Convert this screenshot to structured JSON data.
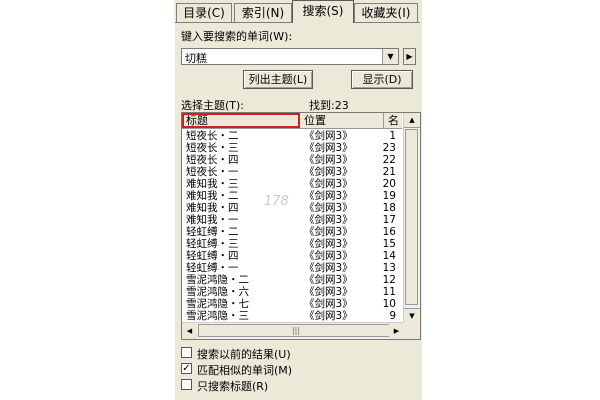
{
  "tabs": [
    {
      "label": "目录(C)"
    },
    {
      "label": "索引(N)"
    },
    {
      "label": "搜索(S)"
    },
    {
      "label": "收藏夹(I)"
    }
  ],
  "search": {
    "prompt": "键入要搜索的单词(W):",
    "value": "切糕",
    "list_topics_label": "列出主题(L)",
    "display_label": "显示(D)"
  },
  "results": {
    "select_label": "选择主题(T):",
    "found_label": "找到:23",
    "columns": [
      "标题",
      "位置",
      "名"
    ],
    "rows": [
      {
        "title": "短夜长・二",
        "location": "《剑网3》",
        "rank": "1"
      },
      {
        "title": "短夜长・三",
        "location": "《剑网3》",
        "rank": "23"
      },
      {
        "title": "短夜长・四",
        "location": "《剑网3》",
        "rank": "22"
      },
      {
        "title": "短夜长・一",
        "location": "《剑网3》",
        "rank": "21"
      },
      {
        "title": "难知我・三",
        "location": "《剑网3》",
        "rank": "20"
      },
      {
        "title": "难知我・二",
        "location": "《剑网3》",
        "rank": "19"
      },
      {
        "title": "难知我・四",
        "location": "《剑网3》",
        "rank": "18"
      },
      {
        "title": "难知我・一",
        "location": "《剑网3》",
        "rank": "17"
      },
      {
        "title": "轻虹缚・二",
        "location": "《剑网3》",
        "rank": "16"
      },
      {
        "title": "轻虹缚・三",
        "location": "《剑网3》",
        "rank": "15"
      },
      {
        "title": "轻虹缚・四",
        "location": "《剑网3》",
        "rank": "14"
      },
      {
        "title": "轻虹缚・一",
        "location": "《剑网3》",
        "rank": "13"
      },
      {
        "title": "雪泥鸿隐・二",
        "location": "《剑网3》",
        "rank": "12"
      },
      {
        "title": "雪泥鸿隐・六",
        "location": "《剑网3》",
        "rank": "11"
      },
      {
        "title": "雪泥鸿隐・七",
        "location": "《剑网3》",
        "rank": "10"
      },
      {
        "title": "雪泥鸿隐・三",
        "location": "《剑网3》",
        "rank": "9"
      }
    ]
  },
  "options": [
    {
      "label": "搜索以前的结果(U)",
      "checked": false
    },
    {
      "label": "匹配相似的单词(M)",
      "checked": true
    },
    {
      "label": "只搜索标题(R)",
      "checked": false
    }
  ],
  "watermark": "178"
}
